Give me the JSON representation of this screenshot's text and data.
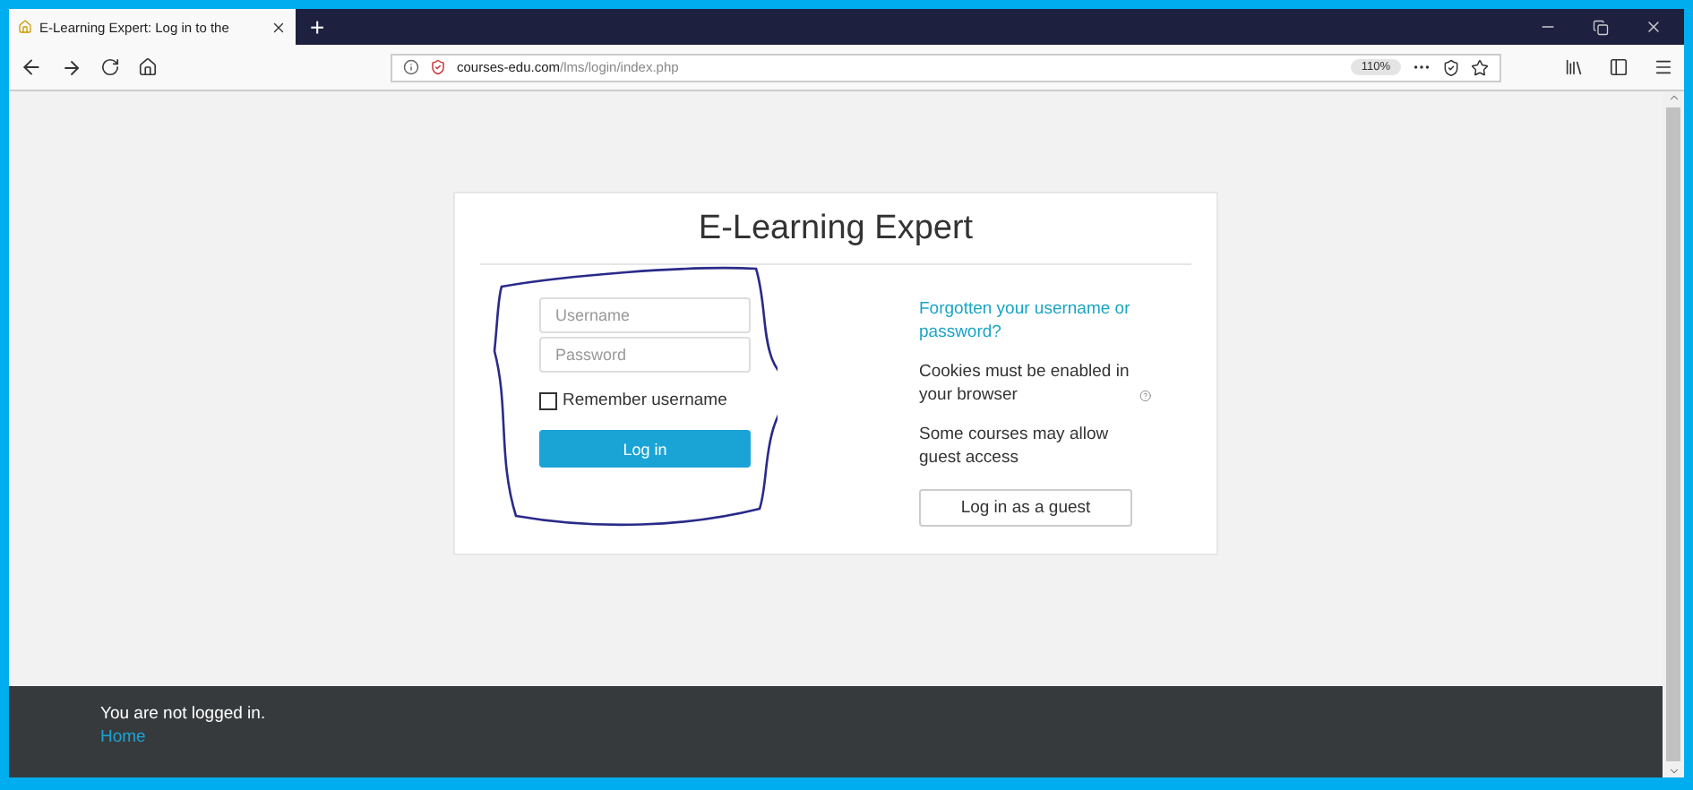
{
  "browser": {
    "tab": {
      "title": "E-Learning Expert: Log in to the",
      "selected": true
    },
    "new_tab": "+",
    "url": {
      "domain": "courses-edu.com",
      "path": "/lms/login/index.php"
    },
    "zoom": "110%"
  },
  "login": {
    "title": "E-Learning Expert",
    "username": {
      "placeholder": "Username"
    },
    "password": {
      "placeholder": "Password"
    },
    "remember": {
      "label": "Remember username",
      "checked": false
    },
    "submit": "Log in",
    "forgot_link": "Forgotten your username or password?",
    "cookies_note": "Cookies must be enabled in your browser",
    "guest_note": "Some courses may allow guest access",
    "guest_button": "Log in as a guest"
  },
  "footer": {
    "status": "You are not logged in.",
    "home_link": "Home"
  }
}
